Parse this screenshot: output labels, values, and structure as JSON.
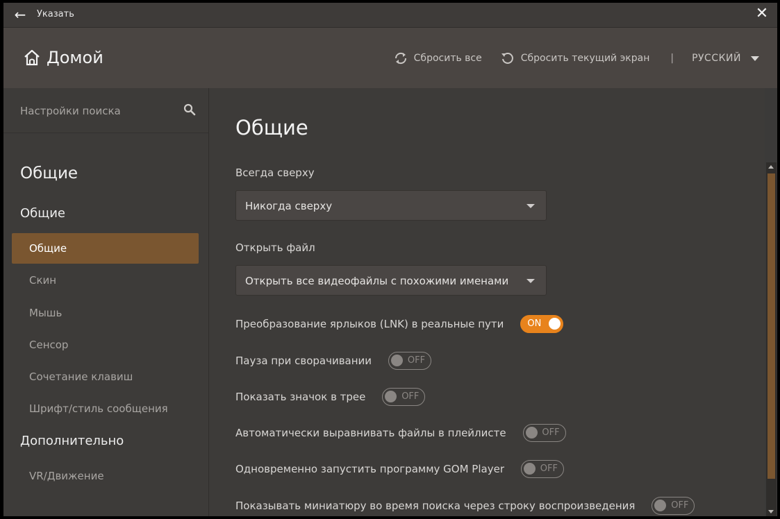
{
  "titlebar": {
    "title": "Указать"
  },
  "header": {
    "home_label": "Домой",
    "reset_all": "Сбросить все",
    "reset_screen": "Сбросить текущий экран",
    "separator": "|",
    "language": "РУССКИЙ"
  },
  "sidebar": {
    "search_placeholder": "Настройки поиска",
    "section_title": "Общие",
    "group_general": "Общие",
    "items": [
      {
        "label": "Общие",
        "active": true
      },
      {
        "label": "Скин"
      },
      {
        "label": "Мышь"
      },
      {
        "label": "Сенсор"
      },
      {
        "label": "Сочетание клавиш"
      },
      {
        "label": "Шрифт/стиль сообщения"
      }
    ],
    "group_additional": "Дополнительно",
    "additional_items": [
      {
        "label": "VR/Движение"
      }
    ]
  },
  "main": {
    "title": "Общие",
    "always_on_top": {
      "label": "Всегда сверху",
      "value": "Никогда сверху"
    },
    "open_file": {
      "label": "Открыть файл",
      "value": "Открыть все видеофайлы с похожими именами"
    },
    "toggles": [
      {
        "label": "Преобразование ярлыков (LNK) в реальные пути",
        "state": "ON"
      },
      {
        "label": "Пауза при сворачивании",
        "state": "OFF"
      },
      {
        "label": "Показать значок в трее",
        "state": "OFF"
      },
      {
        "label": "Автоматически выравнивать файлы в плейлисте",
        "state": "OFF"
      },
      {
        "label": "Одновременно запустить программу GOM Player",
        "state": "OFF"
      },
      {
        "label": "Показывать миниатюру во время поиска через строку воспроизведения",
        "state": "OFF"
      }
    ]
  },
  "colors": {
    "accent": "#e8831c",
    "active_item": "#7a5630",
    "background": "#3d3b39",
    "header": "#4a4542"
  },
  "icons": [
    "back-arrow-icon",
    "close-icon",
    "home-icon",
    "reset-all-icon",
    "reset-screen-icon",
    "caret-down-icon",
    "search-icon"
  ]
}
